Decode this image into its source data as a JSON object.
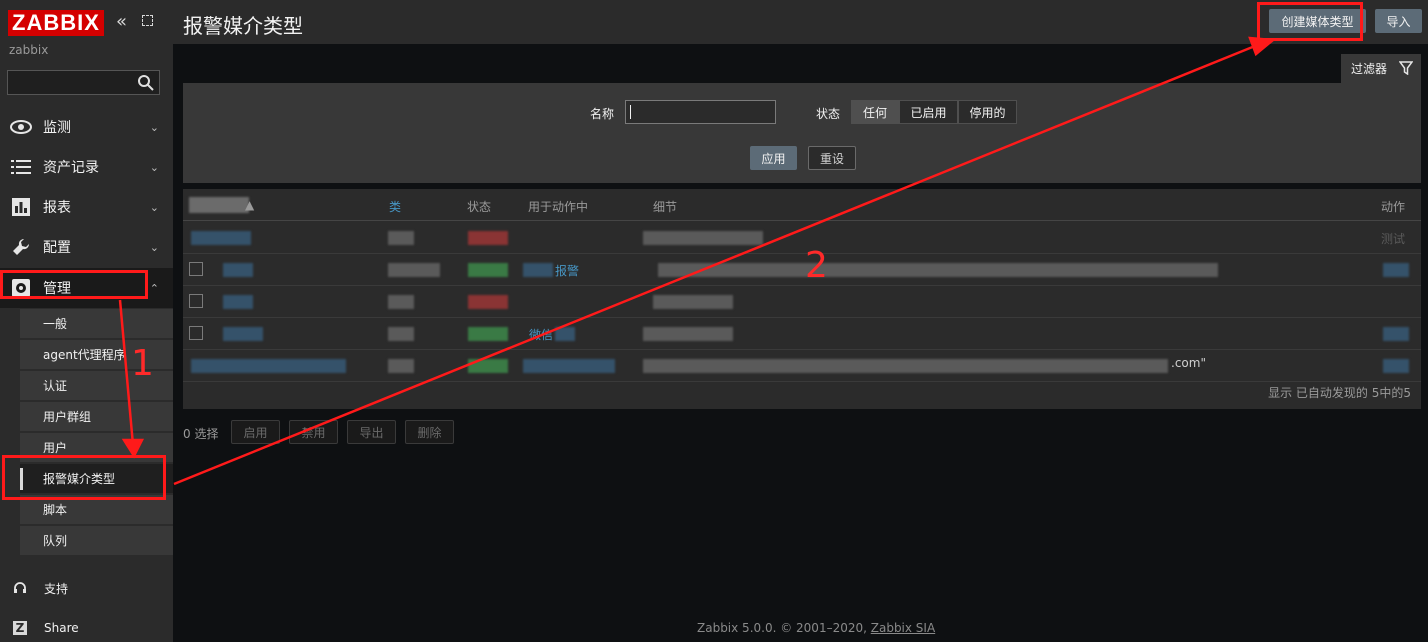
{
  "sidebar": {
    "logo": "ZABBIX",
    "server_name": "zabbix",
    "collapse_glyph": "«",
    "search_placeholder": "",
    "menu": [
      {
        "label": "监测",
        "icon": "eye-icon"
      },
      {
        "label": "资产记录",
        "icon": "list-icon"
      },
      {
        "label": "报表",
        "icon": "bar-chart-icon"
      },
      {
        "label": "配置",
        "icon": "wrench-icon"
      },
      {
        "label": "管理",
        "icon": "gear-icon"
      }
    ],
    "submenu": [
      "一般",
      "agent代理程序",
      "认证",
      "用户群组",
      "用户",
      "报警媒介类型",
      "脚本",
      "队列"
    ],
    "bottom": [
      {
        "label": "支持",
        "icon": "headset-icon"
      },
      {
        "label": "Share",
        "icon": "zabbix-share-icon"
      }
    ]
  },
  "header": {
    "title": "报警媒介类型",
    "create_button": "创建媒体类型",
    "import_button": "导入"
  },
  "filter": {
    "tab_label": "过滤器",
    "name_label": "名称",
    "name_value": "",
    "status_label": "状态",
    "status_options": [
      "任何",
      "已启用",
      "停用的"
    ],
    "status_selected": "任何",
    "apply_button": "应用",
    "reset_button": "重设"
  },
  "table": {
    "columns": {
      "name": "▲",
      "type": "类",
      "status": "状态",
      "used_in_actions": "用于动作中",
      "details": "细节",
      "action": "动作"
    },
    "row_1_action": "测试",
    "row_2_used_in": "报警",
    "row_4_used_in": "微信",
    "row_5_details_tail": ".com\"",
    "footer": "显示 已自动发现的 5中的5"
  },
  "mass_actions": {
    "selected": "0 选择",
    "buttons": [
      "启用",
      "禁用",
      "导出",
      "删除"
    ]
  },
  "footer": {
    "text": "Zabbix 5.0.0. © 2001–2020, ",
    "company": "Zabbix SIA"
  },
  "annotations": {
    "step1": "1",
    "step2": "2"
  },
  "colors": {
    "logo_red": "#d40000",
    "link_blue": "#4796c4",
    "button_bg": "#5c6b77",
    "annotation_red": "#ff1a1a"
  }
}
